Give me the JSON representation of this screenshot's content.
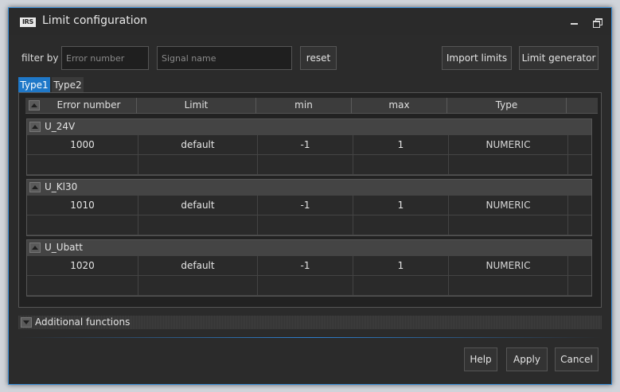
{
  "window": {
    "title": "Limit configuration",
    "logo": "IRS",
    "min_icon": "minimize-icon",
    "max_icon": "restore-icon"
  },
  "filter": {
    "label": "filter by",
    "error_placeholder": "Error number",
    "signal_placeholder": "Signal name",
    "reset_label": "reset"
  },
  "toolbar": {
    "import_label": "Import limits",
    "generator_label": "Limit generator"
  },
  "tabs": [
    {
      "label": "Type1",
      "active": true
    },
    {
      "label": "Type2",
      "active": false
    }
  ],
  "table": {
    "columns": [
      "Error number",
      "Limit",
      "min",
      "max",
      "Type"
    ],
    "groups": [
      {
        "name": "U_24V",
        "rows": [
          {
            "error": "1000",
            "limit": "default",
            "min": "-1",
            "max": "1",
            "type": "NUMERIC"
          }
        ]
      },
      {
        "name": "U_Kl30",
        "rows": [
          {
            "error": "1010",
            "limit": "default",
            "min": "-1",
            "max": "1",
            "type": "NUMERIC"
          }
        ]
      },
      {
        "name": "U_Ubatt",
        "rows": [
          {
            "error": "1020",
            "limit": "default",
            "min": "-1",
            "max": "1",
            "type": "NUMERIC"
          }
        ]
      }
    ]
  },
  "additional": {
    "label": "Additional functions"
  },
  "footer": {
    "help_label": "Help",
    "apply_label": "Apply",
    "cancel_label": "Cancel"
  },
  "colors": {
    "accent": "#1f78c8",
    "border": "#3a8fd8",
    "background": "#2b2b2b"
  }
}
